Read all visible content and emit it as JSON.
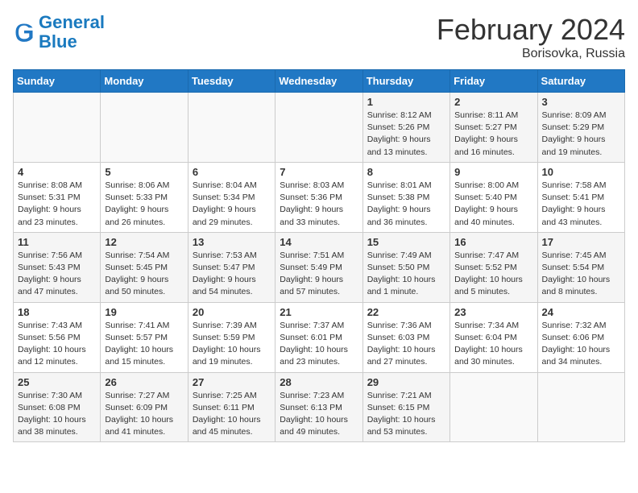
{
  "header": {
    "logo_line1": "General",
    "logo_line2": "Blue",
    "month": "February 2024",
    "location": "Borisovka, Russia"
  },
  "weekdays": [
    "Sunday",
    "Monday",
    "Tuesday",
    "Wednesday",
    "Thursday",
    "Friday",
    "Saturday"
  ],
  "weeks": [
    [
      {
        "day": "",
        "info": ""
      },
      {
        "day": "",
        "info": ""
      },
      {
        "day": "",
        "info": ""
      },
      {
        "day": "",
        "info": ""
      },
      {
        "day": "1",
        "info": "Sunrise: 8:12 AM\nSunset: 5:26 PM\nDaylight: 9 hours\nand 13 minutes."
      },
      {
        "day": "2",
        "info": "Sunrise: 8:11 AM\nSunset: 5:27 PM\nDaylight: 9 hours\nand 16 minutes."
      },
      {
        "day": "3",
        "info": "Sunrise: 8:09 AM\nSunset: 5:29 PM\nDaylight: 9 hours\nand 19 minutes."
      }
    ],
    [
      {
        "day": "4",
        "info": "Sunrise: 8:08 AM\nSunset: 5:31 PM\nDaylight: 9 hours\nand 23 minutes."
      },
      {
        "day": "5",
        "info": "Sunrise: 8:06 AM\nSunset: 5:33 PM\nDaylight: 9 hours\nand 26 minutes."
      },
      {
        "day": "6",
        "info": "Sunrise: 8:04 AM\nSunset: 5:34 PM\nDaylight: 9 hours\nand 29 minutes."
      },
      {
        "day": "7",
        "info": "Sunrise: 8:03 AM\nSunset: 5:36 PM\nDaylight: 9 hours\nand 33 minutes."
      },
      {
        "day": "8",
        "info": "Sunrise: 8:01 AM\nSunset: 5:38 PM\nDaylight: 9 hours\nand 36 minutes."
      },
      {
        "day": "9",
        "info": "Sunrise: 8:00 AM\nSunset: 5:40 PM\nDaylight: 9 hours\nand 40 minutes."
      },
      {
        "day": "10",
        "info": "Sunrise: 7:58 AM\nSunset: 5:41 PM\nDaylight: 9 hours\nand 43 minutes."
      }
    ],
    [
      {
        "day": "11",
        "info": "Sunrise: 7:56 AM\nSunset: 5:43 PM\nDaylight: 9 hours\nand 47 minutes."
      },
      {
        "day": "12",
        "info": "Sunrise: 7:54 AM\nSunset: 5:45 PM\nDaylight: 9 hours\nand 50 minutes."
      },
      {
        "day": "13",
        "info": "Sunrise: 7:53 AM\nSunset: 5:47 PM\nDaylight: 9 hours\nand 54 minutes."
      },
      {
        "day": "14",
        "info": "Sunrise: 7:51 AM\nSunset: 5:49 PM\nDaylight: 9 hours\nand 57 minutes."
      },
      {
        "day": "15",
        "info": "Sunrise: 7:49 AM\nSunset: 5:50 PM\nDaylight: 10 hours\nand 1 minute."
      },
      {
        "day": "16",
        "info": "Sunrise: 7:47 AM\nSunset: 5:52 PM\nDaylight: 10 hours\nand 5 minutes."
      },
      {
        "day": "17",
        "info": "Sunrise: 7:45 AM\nSunset: 5:54 PM\nDaylight: 10 hours\nand 8 minutes."
      }
    ],
    [
      {
        "day": "18",
        "info": "Sunrise: 7:43 AM\nSunset: 5:56 PM\nDaylight: 10 hours\nand 12 minutes."
      },
      {
        "day": "19",
        "info": "Sunrise: 7:41 AM\nSunset: 5:57 PM\nDaylight: 10 hours\nand 15 minutes."
      },
      {
        "day": "20",
        "info": "Sunrise: 7:39 AM\nSunset: 5:59 PM\nDaylight: 10 hours\nand 19 minutes."
      },
      {
        "day": "21",
        "info": "Sunrise: 7:37 AM\nSunset: 6:01 PM\nDaylight: 10 hours\nand 23 minutes."
      },
      {
        "day": "22",
        "info": "Sunrise: 7:36 AM\nSunset: 6:03 PM\nDaylight: 10 hours\nand 27 minutes."
      },
      {
        "day": "23",
        "info": "Sunrise: 7:34 AM\nSunset: 6:04 PM\nDaylight: 10 hours\nand 30 minutes."
      },
      {
        "day": "24",
        "info": "Sunrise: 7:32 AM\nSunset: 6:06 PM\nDaylight: 10 hours\nand 34 minutes."
      }
    ],
    [
      {
        "day": "25",
        "info": "Sunrise: 7:30 AM\nSunset: 6:08 PM\nDaylight: 10 hours\nand 38 minutes."
      },
      {
        "day": "26",
        "info": "Sunrise: 7:27 AM\nSunset: 6:09 PM\nDaylight: 10 hours\nand 41 minutes."
      },
      {
        "day": "27",
        "info": "Sunrise: 7:25 AM\nSunset: 6:11 PM\nDaylight: 10 hours\nand 45 minutes."
      },
      {
        "day": "28",
        "info": "Sunrise: 7:23 AM\nSunset: 6:13 PM\nDaylight: 10 hours\nand 49 minutes."
      },
      {
        "day": "29",
        "info": "Sunrise: 7:21 AM\nSunset: 6:15 PM\nDaylight: 10 hours\nand 53 minutes."
      },
      {
        "day": "",
        "info": ""
      },
      {
        "day": "",
        "info": ""
      }
    ]
  ]
}
